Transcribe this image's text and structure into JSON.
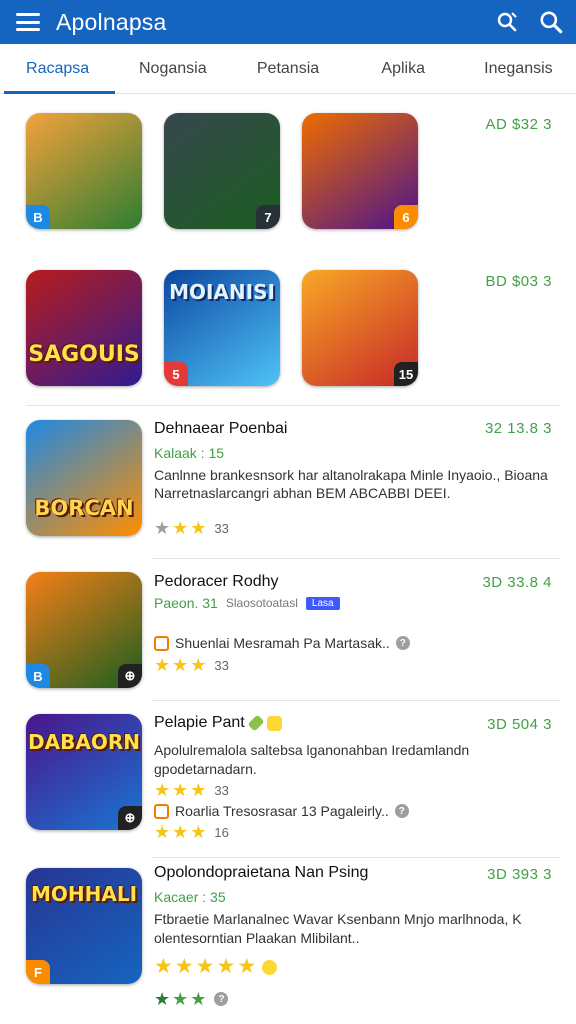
{
  "header": {
    "app_title": "Apolnapsa",
    "icons": [
      "menu-icon",
      "filter-search-icon",
      "search-icon"
    ]
  },
  "tabs": [
    {
      "label": "Racapsa",
      "active": true
    },
    {
      "label": "Nogansia",
      "active": false
    },
    {
      "label": "Petansia",
      "active": false
    },
    {
      "label": "Aplika",
      "active": false
    },
    {
      "label": "Inegansis",
      "active": false
    }
  ],
  "grid_rows": [
    {
      "price": "AD $32 3",
      "tiles": [
        {
          "word": "",
          "badge": "B",
          "badge_color": "#1e88e5",
          "bg": [
            "#f4a23b",
            "#2e7d32"
          ]
        },
        {
          "word": "",
          "badge": "7",
          "badge_color": "#263238",
          "bg": [
            "#37474f",
            "#1b5e20"
          ]
        },
        {
          "word": "",
          "badge": "6",
          "badge_color": "#fb8c00",
          "bg": [
            "#ef6c00",
            "#4a148c"
          ]
        }
      ]
    },
    {
      "price": "BD $03 3",
      "tiles": [
        {
          "word": "SAGOUIS",
          "badge": "",
          "badge_color": "",
          "bg": [
            "#b71c1c",
            "#311b92"
          ]
        },
        {
          "word": "MOIANISI",
          "badge": "5",
          "badge_color": "#e53935",
          "bg": [
            "#0d47a1",
            "#4fc3f7"
          ]
        },
        {
          "word": "",
          "badge": "15",
          "badge_color": "#212121",
          "bg": [
            "#f9a825",
            "#c62828"
          ]
        }
      ]
    }
  ],
  "list": [
    {
      "title": "Dehnaear Poenbai",
      "price": "32 13.8 3",
      "sub": "Kalaak : 15",
      "desc": "Canlnne brankesnsork har altanolrakapa Minle Inyaoio., Bioana Narretnaslarcangri abhan BEM ABCABBI DEEI.",
      "rating": "33",
      "stars": 2,
      "thumb_word": "BORCAN",
      "thumb_bg": [
        "#1e88e5",
        "#ff8f00"
      ]
    },
    {
      "title": "Pedoracer Rodhy",
      "price": "3D 33.8 4",
      "sub": "Paeon. 31",
      "sub_extra": "Slaosotoatasl",
      "sub_tag": "Lasa",
      "meta": "Shuenlai Mesramah Pa Martasak..",
      "rating": "33",
      "stars": 3,
      "thumb_word": "",
      "thumb_bg": [
        "#f57f17",
        "#1b5e20"
      ]
    },
    {
      "title": "Pelapie Pant",
      "price": "3D 504 3",
      "desc": "Apolulremalola saltebsa lganonahban Iredamlandn gpodetarnadarn.",
      "rating": "33",
      "meta": "Roarlia Tresosrasar 13 Pagaleirly..",
      "rating2": "16",
      "stars": 3,
      "thumb_word": "DABAORN",
      "thumb_bg": [
        "#4a148c",
        "#1976d2"
      ]
    },
    {
      "title": "Opolondopraietana Nan Psing",
      "price": "3D 393 3",
      "sub": "Kacaer : 35",
      "desc": "Ftbraetie Marlanalnec Wavar Ksenbann Mnjo marlhnoda, K olentesorntian Plaakan Mlibilant..",
      "stars": 5,
      "stars2": 3,
      "thumb_word": "MOHHALI",
      "thumb_bg": [
        "#283593",
        "#1565c0"
      ]
    }
  ]
}
